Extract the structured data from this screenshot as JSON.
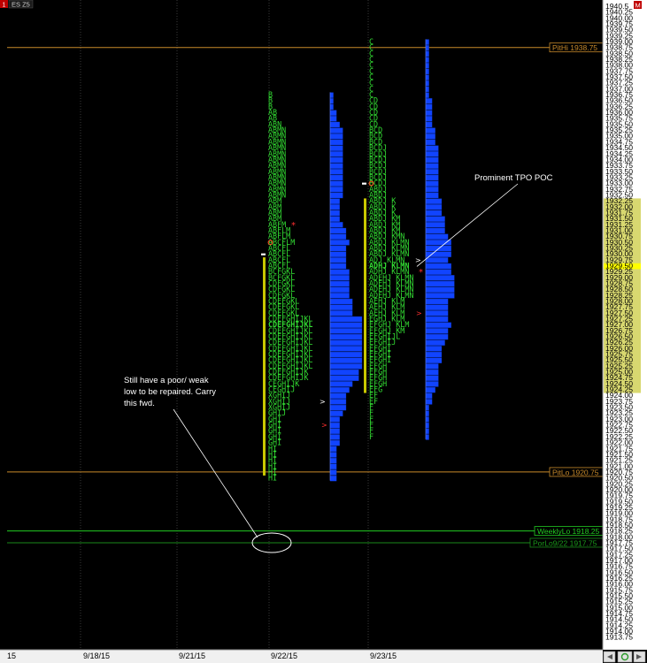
{
  "header": {
    "symbol": "ES Z5",
    "badge_left": "1",
    "badge_right": "M"
  },
  "colors": {
    "tpo": "#33dd33",
    "bar": "#1144ff",
    "value_area": "#c8c800",
    "pit": "#c88a2a",
    "weekly": "#22cc22",
    "axis_hl": "#d8d870",
    "axis_bg": "#ffffff"
  },
  "chart_data": {
    "type": "tpo-profile",
    "price_range": [
      1913.75,
      1940.5
    ],
    "tick_size": 0.25,
    "price_labels_ticks": [
      "1940.5",
      "1940.25",
      "1940.00",
      "1939.75",
      "1939.50",
      "1939.25",
      "1939.00",
      "1938.75",
      "1938.50",
      "1938.25",
      "1938.00",
      "1937.75",
      "1937.50",
      "1937.25",
      "1937.00",
      "1936.75",
      "1936.50",
      "1936.25",
      "1936.00",
      "1935.75",
      "1935.50",
      "1935.25",
      "1935.00",
      "1934.75",
      "1934.50",
      "1934.25",
      "1934.00",
      "1933.75",
      "1933.50",
      "1933.25",
      "1933.00",
      "1932.75",
      "1932.50",
      "1932.25",
      "1932.00",
      "1931.75",
      "1931.50",
      "1931.25",
      "1931.00",
      "1930.75",
      "1930.50",
      "1930.25",
      "1930.00",
      "1929.75",
      "1929.50",
      "1929.25",
      "1929.00",
      "1928.75",
      "1928.50",
      "1928.25",
      "1928.00",
      "1927.75",
      "1927.50",
      "1927.25",
      "1927.00",
      "1926.75",
      "1926.50",
      "1926.25",
      "1926.00",
      "1925.75",
      "1925.50",
      "1925.25",
      "1925.00",
      "1924.75",
      "1924.50",
      "1924.25",
      "1924.00",
      "1923.75",
      "1923.50",
      "1923.25",
      "1923.00",
      "1922.75",
      "1922.50",
      "1922.25",
      "1922.00",
      "1921.75",
      "1921.50",
      "1921.25",
      "1921.00",
      "1920.75",
      "1920.50",
      "1920.25",
      "1920.00",
      "1919.75",
      "1919.50",
      "1919.25",
      "1919.00",
      "1918.75",
      "1918.50",
      "1918.25",
      "1918.00",
      "1917.75",
      "1917.50",
      "1917.25",
      "1917.00",
      "1916.75",
      "1916.50",
      "1916.25",
      "1916.00",
      "1915.75",
      "1915.50",
      "1915.25",
      "1915.00",
      "1914.75",
      "1914.50",
      "1914.25",
      "1914.00",
      "1913.75"
    ],
    "highlight_range": [
      1924.25,
      1932.25
    ],
    "current_price": "1929.50",
    "marked_price": "1932.75",
    "x_labels": [
      "15",
      "9/18/15",
      "9/21/15",
      "9/22/15",
      "9/23/15"
    ],
    "levels": [
      {
        "name": "PitHi 1938.75",
        "price": 1938.75,
        "kind": "pit"
      },
      {
        "name": "PitLo 1920.75",
        "price": 1920.75,
        "kind": "pit"
      },
      {
        "name": "WeeklyLo 1918.25",
        "price": 1918.25,
        "kind": "weekly"
      },
      {
        "name": "PorLo9/22 1917.75",
        "price": 1917.75,
        "kind": "porlo"
      }
    ],
    "profiles": [
      {
        "date": "9/22/15",
        "top": 1936.75,
        "rows": [
          "B",
          "B",
          "B",
          "AB",
          "AB",
          "ABN",
          "ABMN",
          "ABMN",
          "ABMN",
          "ABMN",
          "ABMN",
          "ABMN",
          "ABMN",
          "ABMN",
          "ABMN",
          "ABMN",
          "ABMN",
          "ABMN",
          "ABM",
          "ABM",
          "ABM",
          "ABM",
          "ABFM",
          "ABFLM",
          "ABFLM",
          "ABCFLM",
          "ABCFL",
          "ABCFL",
          "ABCFL",
          "ABCFL",
          "BCFGKL",
          "BCFGKL",
          "CDFGKL",
          "CDFGKL",
          "CDFGKL",
          "CDEFGKL",
          "CDEFGKL",
          "CDEFGKL",
          "CDEFGHIJKL",
          "CDEFGHIJKL",
          "CDEFGHIJKL",
          "CDEFGHIJKL",
          "CDEFGHIJKL",
          "CDEFGHIJKL",
          "CDEFGHIJKL",
          "CDEFGHIJKL",
          "CDEFGHIJKL",
          "CDEFGHIJK",
          "CDEFGHIJK",
          "CEGHIJK",
          "CEGHIJ",
          "XGHIJ",
          "XGHIJ",
          "XGHIJ",
          "GHIJ",
          "GHI",
          "GHI",
          "GHI",
          "GHI",
          "GHI",
          "HI",
          "HI",
          "HI",
          "HI",
          "HI",
          "HI"
        ],
        "value_area": [
          1920.75,
          1929.75
        ],
        "poc": 1927.0,
        "open_price": 1930.0,
        "markers": {
          "star": 1931.25,
          "arrow_white": 1923.75,
          "arrow_red": 1922.75
        }
      },
      {
        "date": "9/23/15",
        "top": 1939.0,
        "rows": [
          "C",
          "C",
          "C",
          "C",
          "C",
          "C",
          "C",
          "C",
          "C",
          "C",
          "CD",
          "CD",
          "CD",
          "CD",
          "CD",
          "BCD",
          "BCD",
          "BCD",
          "BCDJ",
          "BCDJ",
          "BCDJ",
          "BCDJ",
          "BCDJ",
          "BCDJ",
          "BCDJ",
          "ABDJ",
          "ABDJ",
          "ABDJ K",
          "ABDJ K",
          "ABDJ K",
          "ABDJ KM",
          "ABDJ KM",
          "ABDJ KM",
          "ABDJ KMN",
          "ABDJ KLMN",
          "ABDJ KLMN",
          "ABDJ KLMN",
          "ADJ KLMN",
          "ADHJ KLMN",
          "ADHJ KLMN",
          "ADEHJ KLMN",
          "ADEHJ KLMN",
          "ADEHJ KLMN",
          "ADEHJ KLMN",
          "AEHJ KLM",
          "AEHJ KLM",
          "AEHJ KLM",
          "EGHJ KLM",
          "EFGHJ KLM",
          "EFGHJ KM",
          "EFGHIJL",
          "EFGHIJ",
          "EFGHI",
          "EFGHI",
          "EFGHI",
          "EFGH",
          "EFGH",
          "EFGH",
          "EFGH",
          "EFG",
          "EF",
          "EF",
          "F",
          "F",
          "F",
          "F",
          "F",
          "F"
        ],
        "value_area": [
          1924.25,
          1932.25
        ],
        "poc": 1929.5,
        "open_price": 1933.0,
        "markers": {
          "star": 1929.25,
          "arrow_white": 1929.75,
          "arrow_red": 1927.5
        }
      }
    ],
    "annotations": [
      {
        "text": "Prominent TPO POC",
        "lines": [
          "Prominent TPO POC"
        ]
      },
      {
        "text": "Still have a poor/ weak low to be repaired. Carry this fwd.",
        "lines": [
          "Still have a poor/ weak",
          "low to be repaired. Carry",
          "this fwd."
        ]
      }
    ]
  }
}
